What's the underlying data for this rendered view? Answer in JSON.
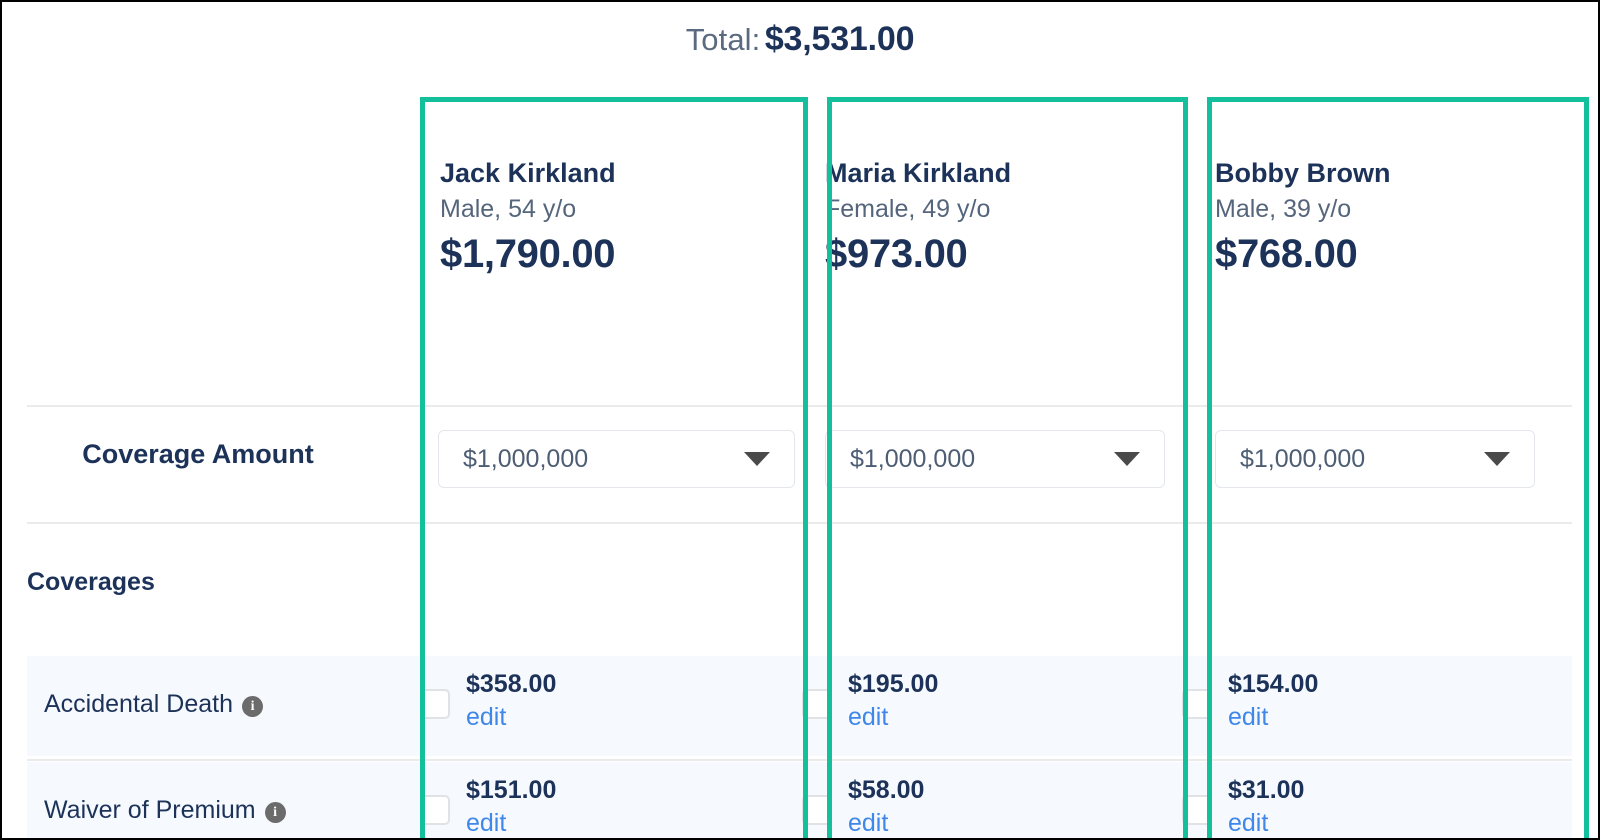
{
  "header": {
    "total_label": "Total:",
    "total_value": "$3,531.00"
  },
  "colors": {
    "accent_teal": "#14bf9b",
    "text_navy": "#1c3259",
    "link_blue": "#3f87e8",
    "row_band": "#f6f9fd",
    "info_icon_gray": "#6b6b6b"
  },
  "labels": {
    "coverage_amount": "Coverage Amount",
    "coverages_heading": "Coverages"
  },
  "people": [
    {
      "name": "Jack Kirkland",
      "meta": "Male, 54 y/o",
      "price": "$1,790.00",
      "coverage_amount": "$1,000,000"
    },
    {
      "name": "Maria Kirkland",
      "meta": "Female, 49 y/o",
      "price": "$973.00",
      "coverage_amount": "$1,000,000"
    },
    {
      "name": "Bobby Brown",
      "meta": "Male, 39 y/o",
      "price": "$768.00",
      "coverage_amount": "$1,000,000"
    }
  ],
  "coverage_rows": [
    {
      "name": "Accidental Death",
      "info_icon": "info-circle-icon",
      "info_glyph": "i",
      "cells": [
        {
          "amount": "$358.00",
          "edit_label": "edit",
          "checked": false
        },
        {
          "amount": "$195.00",
          "edit_label": "edit",
          "checked": false
        },
        {
          "amount": "$154.00",
          "edit_label": "edit",
          "checked": false
        }
      ]
    },
    {
      "name": "Waiver of Premium",
      "info_icon": "info-circle-icon",
      "info_glyph": "i",
      "cells": [
        {
          "amount": "$151.00",
          "edit_label": "edit",
          "checked": false
        },
        {
          "amount": "$58.00",
          "edit_label": "edit",
          "checked": false
        },
        {
          "amount": "$31.00",
          "edit_label": "edit",
          "checked": false
        }
      ]
    }
  ],
  "dropdown": {
    "caret_icon": "chevron-down-filled-icon",
    "options": [
      "$1,000,000"
    ]
  }
}
